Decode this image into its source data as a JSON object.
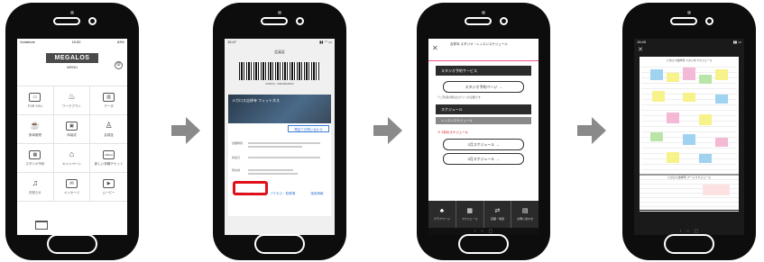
{
  "step1": {
    "status_left": "Vodafone",
    "status_time": "15:52",
    "status_right": "83%",
    "brand": "MEGALOS",
    "menu_label": "MENU",
    "grid": [
      {
        "label": "FOR YOU",
        "icon": "card-icon"
      },
      {
        "label": "ワークアウト",
        "icon": "workout-icon"
      },
      {
        "label": "データ",
        "icon": "data-icon"
      },
      {
        "label": "食事管理",
        "icon": "meal-icon"
      },
      {
        "label": "体組成",
        "icon": "scale-icon"
      },
      {
        "label": "会員証",
        "icon": "member-icon"
      },
      {
        "label": "スタジオ予約",
        "icon": "calendar-icon"
      },
      {
        "label": "キャンペーン",
        "icon": "gift-icon"
      },
      {
        "label": "新しい体験チケット",
        "icon": "ticket-icon"
      },
      {
        "label": "お知らせ",
        "icon": "bell-icon"
      },
      {
        "label": "メッセージ",
        "icon": "mail-icon"
      },
      {
        "label": "ムービー",
        "icon": "movie-icon"
      }
    ]
  },
  "step2": {
    "status_time": "15:47",
    "doc_title": "会員証",
    "barcode_number": "000000 - 00000000000",
    "club_name": "メガロス吉祥寺 フィットネス",
    "call_button": "電話でお問い合わせ",
    "info_rows": [
      "営業時間",
      "休館日",
      "所在地"
    ],
    "tabs": [
      "スケジュール",
      "アクセス・駐車場",
      "施設情報"
    ]
  },
  "step3": {
    "header_title": "吉祥寺 スタジオ・レッスンスケジュール",
    "section_studio": "スタジオ予約サービス",
    "reserve_button": "スタジオ予約ページ →",
    "note": "※ご利用の際はログインが必要です",
    "section_schedule": "スケジュール",
    "sub_schedule": "レッスンスケジュール",
    "red_note": "※ 2月のスケジュール",
    "month_buttons": [
      "2月スケジュール →",
      "3月スケジュール →"
    ],
    "bottom_nav": [
      {
        "label": "クラブページ",
        "icon": "club-icon"
      },
      {
        "label": "スケジュール",
        "icon": "schedule-icon"
      },
      {
        "label": "店舗・地図",
        "icon": "swap-icon"
      },
      {
        "label": "お問い合わせ",
        "icon": "doc-icon"
      }
    ]
  },
  "step4": {
    "status_time": "15:49",
    "sheet_title": "メガロス吉祥寺 スタジオスケジュール",
    "sheet2_title": "メガロス吉祥寺 プールスケジュール"
  }
}
